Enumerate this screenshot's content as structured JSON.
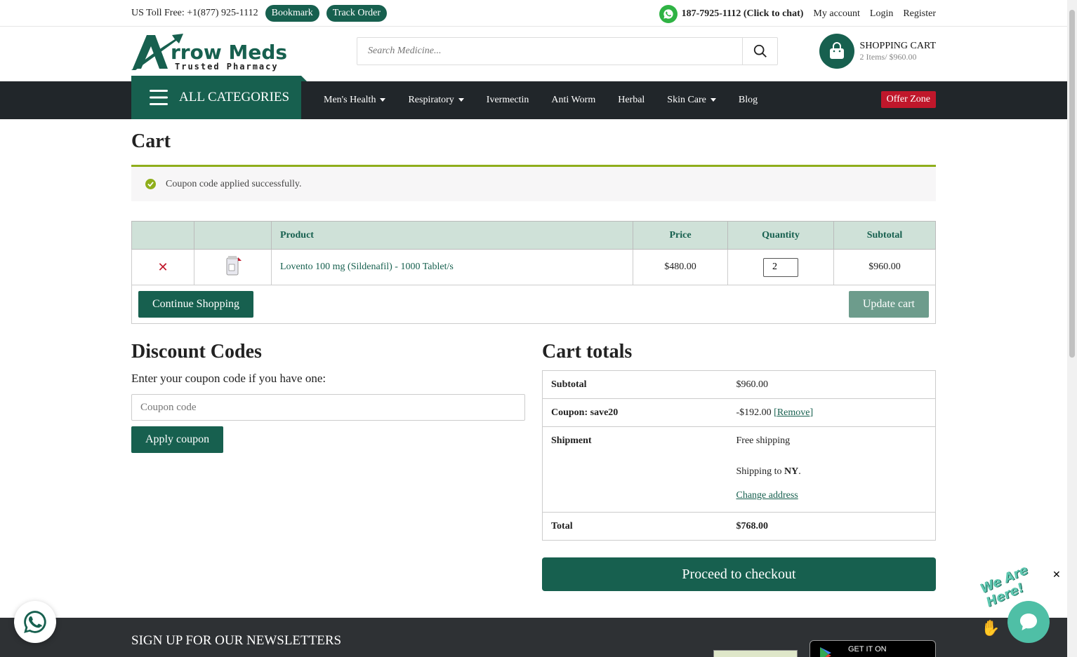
{
  "topbar": {
    "toll_free": "US Toll Free:  +1(877) 925-1112",
    "bookmark": "Bookmark",
    "track_order": "Track Order",
    "chat": "187-7925-1112 (Click to chat)",
    "my_account": "My account",
    "login": "Login",
    "register": "Register"
  },
  "header": {
    "logo_text_1": "rrow Meds",
    "logo_text_2": "Trusted Pharmacy",
    "search_placeholder": "Search Medicine...",
    "cart_label": "SHOPPING CART",
    "cart_summary": "2 Items/ $960.00"
  },
  "nav": {
    "all_categories": "ALL CATEGORIES",
    "items": [
      {
        "label": "Men's Health",
        "dropdown": true
      },
      {
        "label": "Respiratory",
        "dropdown": true
      },
      {
        "label": "Ivermectin",
        "dropdown": false
      },
      {
        "label": "Anti Worm",
        "dropdown": false
      },
      {
        "label": "Herbal",
        "dropdown": false
      },
      {
        "label": "Skin Care",
        "dropdown": true
      },
      {
        "label": "Blog",
        "dropdown": false
      }
    ],
    "offer_zone": "Offer Zone"
  },
  "page": {
    "title": "Cart",
    "notice": "Coupon code applied successfully."
  },
  "cart_table": {
    "headers": [
      "",
      "",
      "Product",
      "Price",
      "Quantity",
      "Subtotal"
    ],
    "rows": [
      {
        "product": "Lovento 100 mg (Sildenafil) - 1000 Tablet/s",
        "price": "$480.00",
        "quantity": "2",
        "subtotal": "$960.00"
      }
    ],
    "continue_shopping": "Continue Shopping",
    "update_cart": "Update cart"
  },
  "discount": {
    "title": "Discount Codes",
    "label": "Enter your coupon code if you have one:",
    "placeholder": "Coupon code",
    "apply": "Apply coupon"
  },
  "totals": {
    "title": "Cart totals",
    "subtotal_label": "Subtotal",
    "subtotal_value": "$960.00",
    "coupon_label": "Coupon: save20",
    "coupon_value": "-$192.00",
    "coupon_remove": "[Remove]",
    "shipment_label": "Shipment",
    "shipment_method": "Free shipping",
    "shipping_to_prefix": "Shipping to ",
    "shipping_to_state": "NY",
    "shipping_to_suffix": ".",
    "change_address": "Change address",
    "total_label": "Total",
    "total_value": "$768.00",
    "checkout": "Proceed to checkout"
  },
  "footer": {
    "newsletter": "SIGN UP FOR OUR NEWSLETTERS",
    "gplay": "GET IT ON"
  },
  "widgets": {
    "we_are_here": "We Are Here!",
    "close": "✕"
  },
  "colors": {
    "brand": "#17604f",
    "nav_bg": "#21262a",
    "offer": "#c0172b",
    "notice_border": "#8fae1b"
  }
}
